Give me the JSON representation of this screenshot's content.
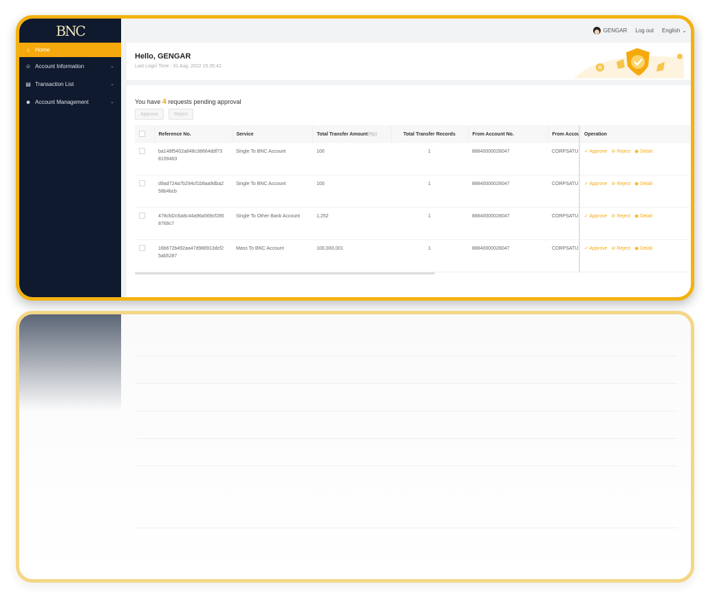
{
  "brand": {
    "logo_text": "BNC",
    "accent": "#f5a90c",
    "sidebar_bg": "#0f1a2e",
    "frame": "#f3b211"
  },
  "sidebar": {
    "items": [
      {
        "label": "Home",
        "icon": "home-icon",
        "active": true
      },
      {
        "label": "Account Information",
        "icon": "user-icon"
      },
      {
        "label": "Transaction List",
        "icon": "list-icon"
      },
      {
        "label": "Account Management",
        "icon": "users-icon"
      }
    ]
  },
  "topbar": {
    "username": "GENGAR",
    "logout": "Log out",
    "language": "English"
  },
  "welcome": {
    "greeting": "Hello, GENGAR",
    "login_time": "Last Login Time : 31 Aug. 2022 15:35:42"
  },
  "pending": {
    "prefix": "You have",
    "count": "4",
    "suffix": "requests pending approval"
  },
  "actions": {
    "approve": "Approve",
    "reject": "Reject"
  },
  "table": {
    "headers": {
      "reference": "Reference No.",
      "service": "Service",
      "amount": "Total Transfer Amount",
      "amount_unit": "(Rp)",
      "records": "Total Transfer Records",
      "from_account": "From Account No.",
      "from_account_name": "From Accou",
      "operation": "Operation"
    },
    "op_labels": {
      "approve": "Approve",
      "reject": "Reject",
      "detail": "Detail"
    },
    "rows": [
      {
        "ref1": "ba148f5402a848c38664ddf73",
        "ref2": "8159463",
        "service": "Single To BNC Account",
        "amount": "100",
        "records": "1",
        "from": "88840000028047",
        "name": "CORPSATU"
      },
      {
        "ref1": "d9ad724a7b294cf1b9aa9dba2",
        "ref2": "58b4bcb",
        "service": "Single To BNC Account",
        "amount": "100",
        "records": "1",
        "from": "88840000028047",
        "name": "CORPSATU"
      },
      {
        "ref1": "478cfd2c6a8c44a96a569cf285",
        "ref2": "8769c7",
        "service": "Single To Other Bank Account",
        "amount": "1,252",
        "records": "1",
        "from": "88840000028047",
        "name": "CORPSATU"
      },
      {
        "ref1": "16b672b492aa47d988913dcf2",
        "ref2": "5ab5287",
        "service": "Mass To BNC Account",
        "amount": "100,000,001",
        "records": "1",
        "from": "88840000028047",
        "name": "CORPSATU"
      }
    ]
  }
}
